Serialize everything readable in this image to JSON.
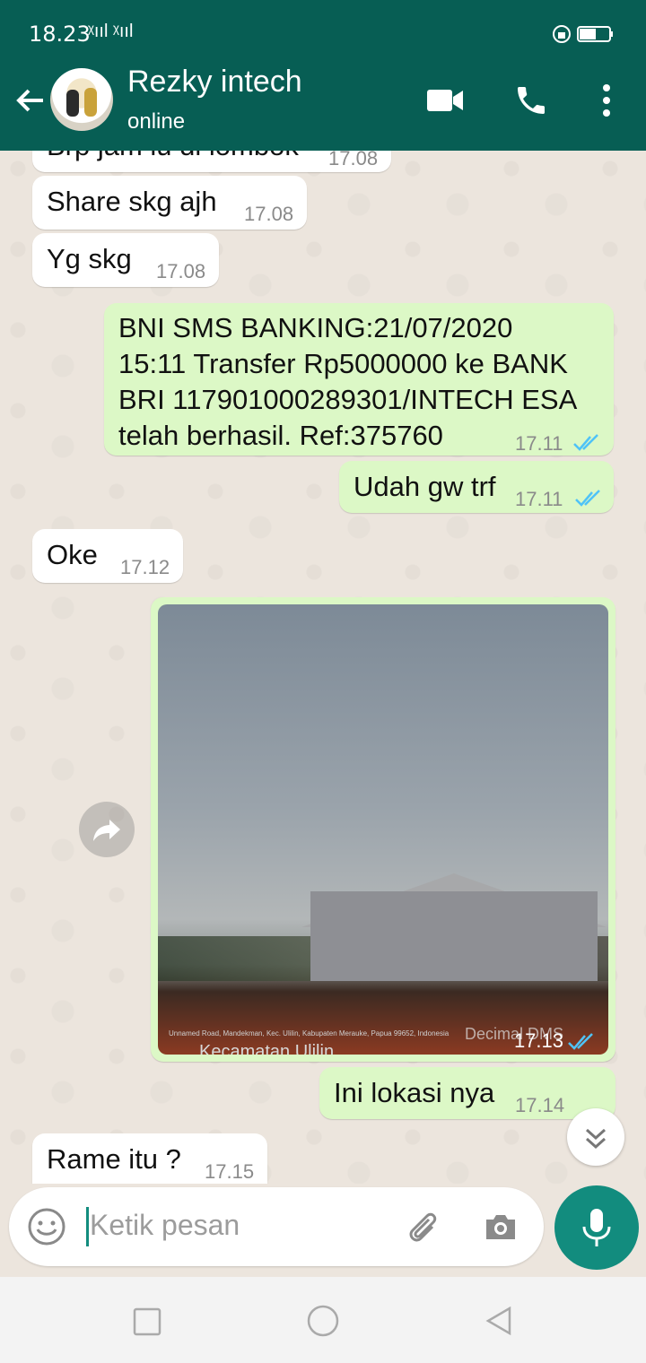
{
  "status_bar": {
    "time": "18.23",
    "signal_text": "ᵡııl ᵡııl"
  },
  "header": {
    "contact_name": "Rezky intech",
    "status": "online"
  },
  "messages": [
    {
      "dir": "in",
      "text": "Brp jam lu di lombok",
      "time": "17.08"
    },
    {
      "dir": "in",
      "text": "Share skg ajh",
      "time": "17.08"
    },
    {
      "dir": "in",
      "text": "Yg skg",
      "time": "17.08"
    },
    {
      "dir": "out",
      "text": "BNI SMS BANKING:21/07/2020\n15:11 Transfer Rp5000000 ke BANK\nBRI 117901000289301/INTECH ESA\ntelah berhasil. Ref:375760",
      "time": "17.11"
    },
    {
      "dir": "out",
      "text": "Udah gw trf",
      "time": "17.11"
    },
    {
      "dir": "in",
      "text": "Oke",
      "time": "17.12"
    },
    {
      "dir": "out",
      "type": "image",
      "time": "17.13",
      "caption_small": "Unnamed Road, Mandekman, Kec. Ulilin, Kabupaten Merauke, Papua 99652, Indonesia",
      "caption_place": "Kecamatan Ulilin",
      "watermark": "Decimal DMS"
    },
    {
      "dir": "out",
      "text": "Ini lokasi nya",
      "time": "17.14"
    },
    {
      "dir": "in",
      "text": "Rame itu ?",
      "time": "17.15"
    }
  ],
  "composer": {
    "placeholder": "Ketik pesan"
  },
  "icons": {
    "back": "arrow-left-icon",
    "video": "video-call-icon",
    "call": "phone-icon",
    "menu": "more-vertical-icon",
    "emoji": "emoji-icon",
    "attach": "paperclip-icon",
    "camera": "camera-icon",
    "mic": "microphone-icon",
    "forward": "forward-icon",
    "scroll": "double-chevron-down-icon"
  },
  "colors": {
    "header": "#075e54",
    "outgoing": "#dcf8c6",
    "incoming": "#ffffff",
    "accent": "#128c7e",
    "read_ticks": "#4fc3f7"
  }
}
